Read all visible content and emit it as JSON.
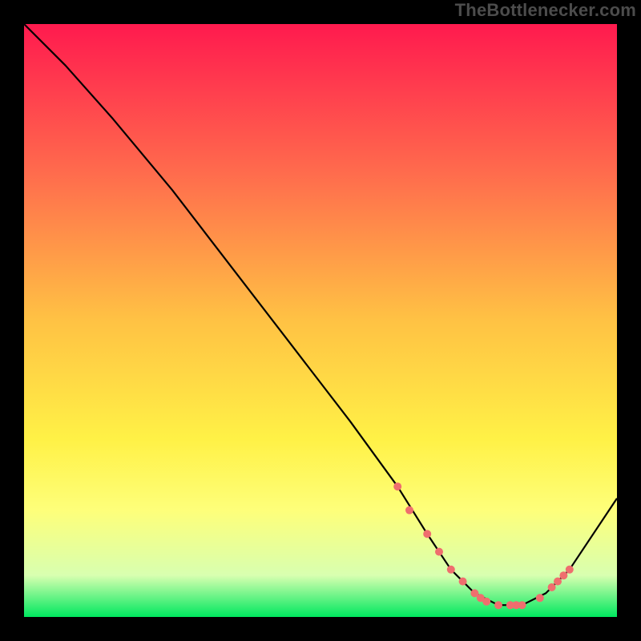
{
  "attribution": "TheBottlenecker.com",
  "chart_data": {
    "type": "line",
    "title": "",
    "xlabel": "",
    "ylabel": "",
    "xlim": [
      0,
      100
    ],
    "ylim": [
      0,
      100
    ],
    "grid": false,
    "background_gradient": {
      "stops": [
        {
          "offset": 0.0,
          "color": "#ff1a4e"
        },
        {
          "offset": 0.25,
          "color": "#ff6b4d"
        },
        {
          "offset": 0.5,
          "color": "#ffc244"
        },
        {
          "offset": 0.7,
          "color": "#fff146"
        },
        {
          "offset": 0.82,
          "color": "#feff7a"
        },
        {
          "offset": 0.93,
          "color": "#d8ffb0"
        },
        {
          "offset": 1.0,
          "color": "#00e85f"
        }
      ]
    },
    "series": [
      {
        "name": "bottleneck-curve",
        "stroke": "#000000",
        "stroke_width": 2.2,
        "x": [
          0,
          7,
          15,
          25,
          35,
          45,
          55,
          63,
          68,
          72,
          76,
          80,
          84,
          88,
          92,
          100
        ],
        "y": [
          100,
          93,
          84,
          72,
          59,
          46,
          33,
          22,
          14,
          8,
          4,
          2,
          2,
          4,
          8,
          20
        ]
      }
    ],
    "markers": {
      "name": "highlight-points",
      "fill": "#ef6e6e",
      "radius": 5,
      "x": [
        63,
        65,
        68,
        70,
        72,
        74,
        76,
        77,
        78,
        80,
        82,
        83,
        84,
        87,
        89,
        90,
        91,
        92
      ],
      "y": [
        22,
        18,
        14,
        11,
        8,
        6,
        4,
        3.2,
        2.6,
        2,
        2,
        2,
        2,
        3.2,
        5,
        6,
        7,
        8
      ]
    }
  }
}
